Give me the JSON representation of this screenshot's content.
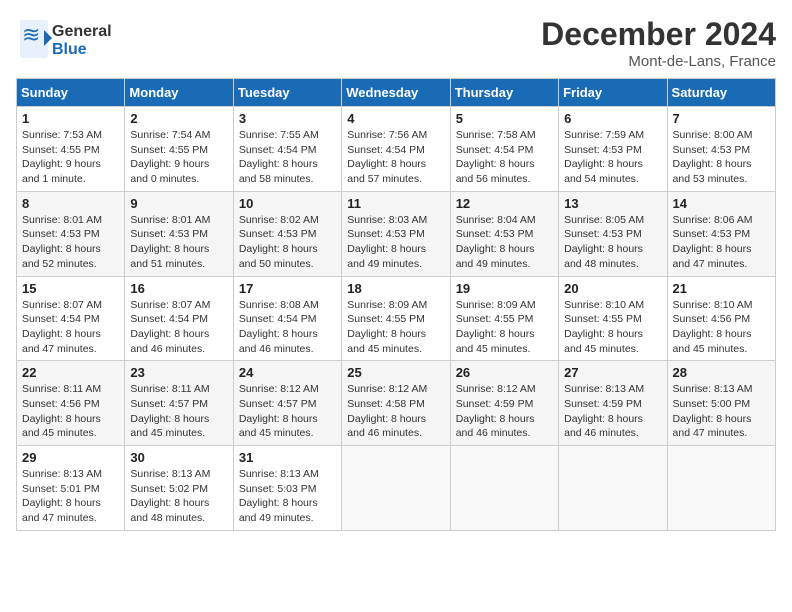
{
  "header": {
    "logo_line1": "General",
    "logo_line2": "Blue",
    "month": "December 2024",
    "location": "Mont-de-Lans, France"
  },
  "weekdays": [
    "Sunday",
    "Monday",
    "Tuesday",
    "Wednesday",
    "Thursday",
    "Friday",
    "Saturday"
  ],
  "weeks": [
    [
      {
        "day": "1",
        "info": "Sunrise: 7:53 AM\nSunset: 4:55 PM\nDaylight: 9 hours\nand 1 minute."
      },
      {
        "day": "2",
        "info": "Sunrise: 7:54 AM\nSunset: 4:55 PM\nDaylight: 9 hours\nand 0 minutes."
      },
      {
        "day": "3",
        "info": "Sunrise: 7:55 AM\nSunset: 4:54 PM\nDaylight: 8 hours\nand 58 minutes."
      },
      {
        "day": "4",
        "info": "Sunrise: 7:56 AM\nSunset: 4:54 PM\nDaylight: 8 hours\nand 57 minutes."
      },
      {
        "day": "5",
        "info": "Sunrise: 7:58 AM\nSunset: 4:54 PM\nDaylight: 8 hours\nand 56 minutes."
      },
      {
        "day": "6",
        "info": "Sunrise: 7:59 AM\nSunset: 4:53 PM\nDaylight: 8 hours\nand 54 minutes."
      },
      {
        "day": "7",
        "info": "Sunrise: 8:00 AM\nSunset: 4:53 PM\nDaylight: 8 hours\nand 53 minutes."
      }
    ],
    [
      {
        "day": "8",
        "info": "Sunrise: 8:01 AM\nSunset: 4:53 PM\nDaylight: 8 hours\nand 52 minutes."
      },
      {
        "day": "9",
        "info": "Sunrise: 8:01 AM\nSunset: 4:53 PM\nDaylight: 8 hours\nand 51 minutes."
      },
      {
        "day": "10",
        "info": "Sunrise: 8:02 AM\nSunset: 4:53 PM\nDaylight: 8 hours\nand 50 minutes."
      },
      {
        "day": "11",
        "info": "Sunrise: 8:03 AM\nSunset: 4:53 PM\nDaylight: 8 hours\nand 49 minutes."
      },
      {
        "day": "12",
        "info": "Sunrise: 8:04 AM\nSunset: 4:53 PM\nDaylight: 8 hours\nand 49 minutes."
      },
      {
        "day": "13",
        "info": "Sunrise: 8:05 AM\nSunset: 4:53 PM\nDaylight: 8 hours\nand 48 minutes."
      },
      {
        "day": "14",
        "info": "Sunrise: 8:06 AM\nSunset: 4:53 PM\nDaylight: 8 hours\nand 47 minutes."
      }
    ],
    [
      {
        "day": "15",
        "info": "Sunrise: 8:07 AM\nSunset: 4:54 PM\nDaylight: 8 hours\nand 47 minutes."
      },
      {
        "day": "16",
        "info": "Sunrise: 8:07 AM\nSunset: 4:54 PM\nDaylight: 8 hours\nand 46 minutes."
      },
      {
        "day": "17",
        "info": "Sunrise: 8:08 AM\nSunset: 4:54 PM\nDaylight: 8 hours\nand 46 minutes."
      },
      {
        "day": "18",
        "info": "Sunrise: 8:09 AM\nSunset: 4:55 PM\nDaylight: 8 hours\nand 45 minutes."
      },
      {
        "day": "19",
        "info": "Sunrise: 8:09 AM\nSunset: 4:55 PM\nDaylight: 8 hours\nand 45 minutes."
      },
      {
        "day": "20",
        "info": "Sunrise: 8:10 AM\nSunset: 4:55 PM\nDaylight: 8 hours\nand 45 minutes."
      },
      {
        "day": "21",
        "info": "Sunrise: 8:10 AM\nSunset: 4:56 PM\nDaylight: 8 hours\nand 45 minutes."
      }
    ],
    [
      {
        "day": "22",
        "info": "Sunrise: 8:11 AM\nSunset: 4:56 PM\nDaylight: 8 hours\nand 45 minutes."
      },
      {
        "day": "23",
        "info": "Sunrise: 8:11 AM\nSunset: 4:57 PM\nDaylight: 8 hours\nand 45 minutes."
      },
      {
        "day": "24",
        "info": "Sunrise: 8:12 AM\nSunset: 4:57 PM\nDaylight: 8 hours\nand 45 minutes."
      },
      {
        "day": "25",
        "info": "Sunrise: 8:12 AM\nSunset: 4:58 PM\nDaylight: 8 hours\nand 46 minutes."
      },
      {
        "day": "26",
        "info": "Sunrise: 8:12 AM\nSunset: 4:59 PM\nDaylight: 8 hours\nand 46 minutes."
      },
      {
        "day": "27",
        "info": "Sunrise: 8:13 AM\nSunset: 4:59 PM\nDaylight: 8 hours\nand 46 minutes."
      },
      {
        "day": "28",
        "info": "Sunrise: 8:13 AM\nSunset: 5:00 PM\nDaylight: 8 hours\nand 47 minutes."
      }
    ],
    [
      {
        "day": "29",
        "info": "Sunrise: 8:13 AM\nSunset: 5:01 PM\nDaylight: 8 hours\nand 47 minutes."
      },
      {
        "day": "30",
        "info": "Sunrise: 8:13 AM\nSunset: 5:02 PM\nDaylight: 8 hours\nand 48 minutes."
      },
      {
        "day": "31",
        "info": "Sunrise: 8:13 AM\nSunset: 5:03 PM\nDaylight: 8 hours\nand 49 minutes."
      },
      null,
      null,
      null,
      null
    ]
  ]
}
